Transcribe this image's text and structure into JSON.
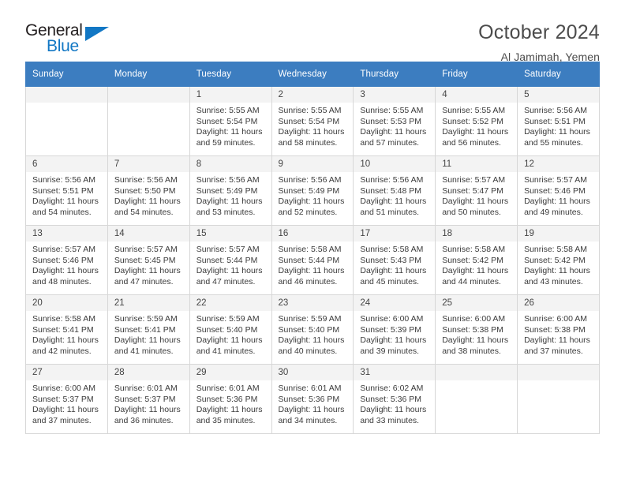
{
  "brand": {
    "name_top": "General",
    "name_bottom": "Blue",
    "accent_color": "#1277c4"
  },
  "header": {
    "title": "October 2024",
    "subtitle": "Al Jamimah, Yemen"
  },
  "calendar": {
    "header_bg": "#3c7dc0",
    "weekdays": [
      "Sunday",
      "Monday",
      "Tuesday",
      "Wednesday",
      "Thursday",
      "Friday",
      "Saturday"
    ],
    "weeks": [
      [
        {
          "day": "",
          "sunrise": "",
          "sunset": "",
          "daylight": "",
          "empty": true
        },
        {
          "day": "",
          "sunrise": "",
          "sunset": "",
          "daylight": "",
          "empty": true
        },
        {
          "day": "1",
          "sunrise": "Sunrise: 5:55 AM",
          "sunset": "Sunset: 5:54 PM",
          "daylight": "Daylight: 11 hours and 59 minutes."
        },
        {
          "day": "2",
          "sunrise": "Sunrise: 5:55 AM",
          "sunset": "Sunset: 5:54 PM",
          "daylight": "Daylight: 11 hours and 58 minutes."
        },
        {
          "day": "3",
          "sunrise": "Sunrise: 5:55 AM",
          "sunset": "Sunset: 5:53 PM",
          "daylight": "Daylight: 11 hours and 57 minutes."
        },
        {
          "day": "4",
          "sunrise": "Sunrise: 5:55 AM",
          "sunset": "Sunset: 5:52 PM",
          "daylight": "Daylight: 11 hours and 56 minutes."
        },
        {
          "day": "5",
          "sunrise": "Sunrise: 5:56 AM",
          "sunset": "Sunset: 5:51 PM",
          "daylight": "Daylight: 11 hours and 55 minutes."
        }
      ],
      [
        {
          "day": "6",
          "sunrise": "Sunrise: 5:56 AM",
          "sunset": "Sunset: 5:51 PM",
          "daylight": "Daylight: 11 hours and 54 minutes."
        },
        {
          "day": "7",
          "sunrise": "Sunrise: 5:56 AM",
          "sunset": "Sunset: 5:50 PM",
          "daylight": "Daylight: 11 hours and 54 minutes."
        },
        {
          "day": "8",
          "sunrise": "Sunrise: 5:56 AM",
          "sunset": "Sunset: 5:49 PM",
          "daylight": "Daylight: 11 hours and 53 minutes."
        },
        {
          "day": "9",
          "sunrise": "Sunrise: 5:56 AM",
          "sunset": "Sunset: 5:49 PM",
          "daylight": "Daylight: 11 hours and 52 minutes."
        },
        {
          "day": "10",
          "sunrise": "Sunrise: 5:56 AM",
          "sunset": "Sunset: 5:48 PM",
          "daylight": "Daylight: 11 hours and 51 minutes."
        },
        {
          "day": "11",
          "sunrise": "Sunrise: 5:57 AM",
          "sunset": "Sunset: 5:47 PM",
          "daylight": "Daylight: 11 hours and 50 minutes."
        },
        {
          "day": "12",
          "sunrise": "Sunrise: 5:57 AM",
          "sunset": "Sunset: 5:46 PM",
          "daylight": "Daylight: 11 hours and 49 minutes."
        }
      ],
      [
        {
          "day": "13",
          "sunrise": "Sunrise: 5:57 AM",
          "sunset": "Sunset: 5:46 PM",
          "daylight": "Daylight: 11 hours and 48 minutes."
        },
        {
          "day": "14",
          "sunrise": "Sunrise: 5:57 AM",
          "sunset": "Sunset: 5:45 PM",
          "daylight": "Daylight: 11 hours and 47 minutes."
        },
        {
          "day": "15",
          "sunrise": "Sunrise: 5:57 AM",
          "sunset": "Sunset: 5:44 PM",
          "daylight": "Daylight: 11 hours and 47 minutes."
        },
        {
          "day": "16",
          "sunrise": "Sunrise: 5:58 AM",
          "sunset": "Sunset: 5:44 PM",
          "daylight": "Daylight: 11 hours and 46 minutes."
        },
        {
          "day": "17",
          "sunrise": "Sunrise: 5:58 AM",
          "sunset": "Sunset: 5:43 PM",
          "daylight": "Daylight: 11 hours and 45 minutes."
        },
        {
          "day": "18",
          "sunrise": "Sunrise: 5:58 AM",
          "sunset": "Sunset: 5:42 PM",
          "daylight": "Daylight: 11 hours and 44 minutes."
        },
        {
          "day": "19",
          "sunrise": "Sunrise: 5:58 AM",
          "sunset": "Sunset: 5:42 PM",
          "daylight": "Daylight: 11 hours and 43 minutes."
        }
      ],
      [
        {
          "day": "20",
          "sunrise": "Sunrise: 5:58 AM",
          "sunset": "Sunset: 5:41 PM",
          "daylight": "Daylight: 11 hours and 42 minutes."
        },
        {
          "day": "21",
          "sunrise": "Sunrise: 5:59 AM",
          "sunset": "Sunset: 5:41 PM",
          "daylight": "Daylight: 11 hours and 41 minutes."
        },
        {
          "day": "22",
          "sunrise": "Sunrise: 5:59 AM",
          "sunset": "Sunset: 5:40 PM",
          "daylight": "Daylight: 11 hours and 41 minutes."
        },
        {
          "day": "23",
          "sunrise": "Sunrise: 5:59 AM",
          "sunset": "Sunset: 5:40 PM",
          "daylight": "Daylight: 11 hours and 40 minutes."
        },
        {
          "day": "24",
          "sunrise": "Sunrise: 6:00 AM",
          "sunset": "Sunset: 5:39 PM",
          "daylight": "Daylight: 11 hours and 39 minutes."
        },
        {
          "day": "25",
          "sunrise": "Sunrise: 6:00 AM",
          "sunset": "Sunset: 5:38 PM",
          "daylight": "Daylight: 11 hours and 38 minutes."
        },
        {
          "day": "26",
          "sunrise": "Sunrise: 6:00 AM",
          "sunset": "Sunset: 5:38 PM",
          "daylight": "Daylight: 11 hours and 37 minutes."
        }
      ],
      [
        {
          "day": "27",
          "sunrise": "Sunrise: 6:00 AM",
          "sunset": "Sunset: 5:37 PM",
          "daylight": "Daylight: 11 hours and 37 minutes."
        },
        {
          "day": "28",
          "sunrise": "Sunrise: 6:01 AM",
          "sunset": "Sunset: 5:37 PM",
          "daylight": "Daylight: 11 hours and 36 minutes."
        },
        {
          "day": "29",
          "sunrise": "Sunrise: 6:01 AM",
          "sunset": "Sunset: 5:36 PM",
          "daylight": "Daylight: 11 hours and 35 minutes."
        },
        {
          "day": "30",
          "sunrise": "Sunrise: 6:01 AM",
          "sunset": "Sunset: 5:36 PM",
          "daylight": "Daylight: 11 hours and 34 minutes."
        },
        {
          "day": "31",
          "sunrise": "Sunrise: 6:02 AM",
          "sunset": "Sunset: 5:36 PM",
          "daylight": "Daylight: 11 hours and 33 minutes."
        },
        {
          "day": "",
          "sunrise": "",
          "sunset": "",
          "daylight": "",
          "empty": true
        },
        {
          "day": "",
          "sunrise": "",
          "sunset": "",
          "daylight": "",
          "empty": true
        }
      ]
    ]
  }
}
